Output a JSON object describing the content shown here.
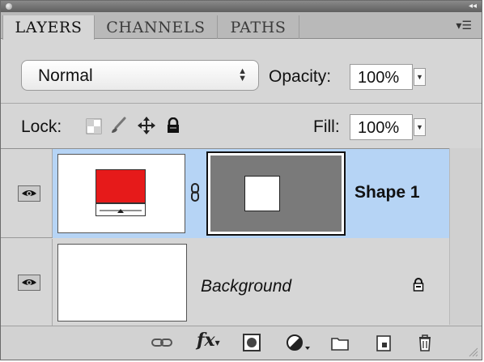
{
  "tabs": [
    {
      "label": "LAYERS",
      "active": true
    },
    {
      "label": "CHANNELS",
      "active": false
    },
    {
      "label": "PATHS",
      "active": false
    }
  ],
  "blend": {
    "mode": "Normal",
    "opacity_label": "Opacity:",
    "opacity": "100%"
  },
  "lock": {
    "label": "Lock:",
    "fill_label": "Fill:",
    "fill": "100%"
  },
  "layers": [
    {
      "name": "Shape 1",
      "selected": true,
      "visible": true,
      "has_mask": true,
      "shape_color": "#e61a1a"
    },
    {
      "name": "Background",
      "selected": false,
      "visible": true,
      "locked": true
    }
  ],
  "colors": {
    "selected_row": "#b6d4f5",
    "panel_bg": "#d6d6d6",
    "mask_gray": "#7a7a7a"
  },
  "footer_icons": [
    "link-layers-icon",
    "fx-icon",
    "add-mask-icon",
    "adjustment-layer-icon",
    "new-group-icon",
    "new-layer-icon",
    "trash-icon"
  ]
}
